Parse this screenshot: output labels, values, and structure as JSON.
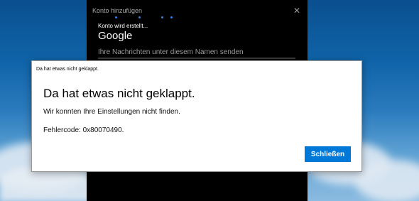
{
  "account_window": {
    "title": "Konto hinzufügen",
    "close_glyph": "✕",
    "status": "Konto wird erstellt...",
    "provider": "Google",
    "hint": "Ihre Nachrichten unter diesem Namen senden",
    "progress_color": "#2f7de1"
  },
  "dialog": {
    "caption": "Da hat etwas nicht geklappt.",
    "heading": "Da hat etwas nicht geklappt.",
    "message": "Wir konnten Ihre Einstellungen nicht finden.",
    "error_code": "Fehlercode: 0x80070490.",
    "close_label": "Schließen",
    "accent": "#0078d7"
  }
}
